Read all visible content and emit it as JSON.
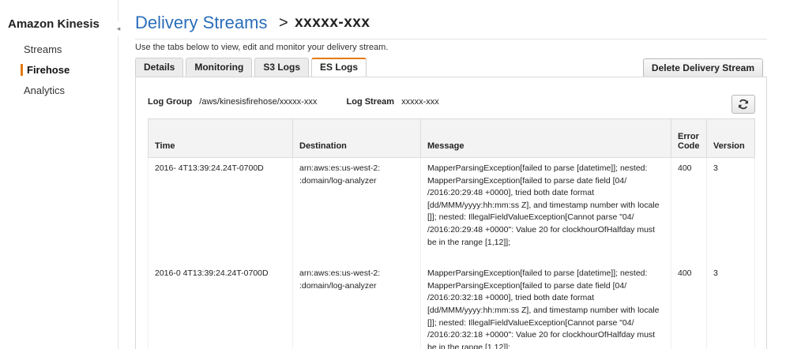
{
  "sidebar": {
    "brand": "Amazon Kinesis",
    "items": [
      {
        "label": "Streams",
        "active": false
      },
      {
        "label": "Firehose",
        "active": true
      },
      {
        "label": "Analytics",
        "active": false
      }
    ],
    "collapse_icon": "◂"
  },
  "header": {
    "breadcrumb_parent": "Delivery Streams",
    "separator": ">",
    "current": "xxxxx-xxx"
  },
  "instructions": "Use the tabs below to view, edit and monitor your delivery stream.",
  "tabs": [
    {
      "label": "Details",
      "active": false
    },
    {
      "label": "Monitoring",
      "active": false
    },
    {
      "label": "S3 Logs",
      "active": false
    },
    {
      "label": "ES Logs",
      "active": true
    }
  ],
  "actions": {
    "delete_label": "Delete Delivery Stream",
    "refresh_icon": "refresh-icon"
  },
  "log_info": {
    "group_label": "Log Group",
    "group_value": "/aws/kinesisfirehose/xxxxx-xxx",
    "stream_label": "Log Stream",
    "stream_value": "xxxxx-xxx"
  },
  "table": {
    "columns": [
      "Time",
      "Destination",
      "Message",
      "Error Code",
      "Version"
    ],
    "rows": [
      {
        "time": "2016-  4T13:39:24.24T-0700D",
        "destination": "arn:aws:es:us-west-2:  :domain/log-analyzer",
        "message": "MapperParsingException[failed to parse [datetime]]; nested: MapperParsingException[failed to parse date field [04/  /2016:20:29:48 +0000], tried both date format [dd/MMM/yyyy:hh:mm:ss Z], and timestamp number with locale []]; nested: IllegalFieldValueException[Cannot parse \"04/  /2016:20:29:48 +0000\": Value 20 for clockhourOfHalfday must be in the range [1,12]];",
        "error_code": "400",
        "version": "3"
      },
      {
        "time": "2016-0  4T13:39:24.24T-0700D",
        "destination": "arn:aws:es:us-west-2:  :domain/log-analyzer",
        "message": "MapperParsingException[failed to parse [datetime]]; nested: MapperParsingException[failed to parse date field [04/  /2016:20:32:18 +0000], tried both date format [dd/MMM/yyyy:hh:mm:ss Z], and timestamp number with locale []]; nested: IllegalFieldValueException[Cannot parse \"04/  /2016:20:32:18 +0000\": Value 20 for clockhourOfHalfday must be in the range [1,12]];",
        "error_code": "400",
        "version": "3"
      }
    ]
  },
  "colors": {
    "accent": "#e47911",
    "link": "#2a6ebb"
  }
}
